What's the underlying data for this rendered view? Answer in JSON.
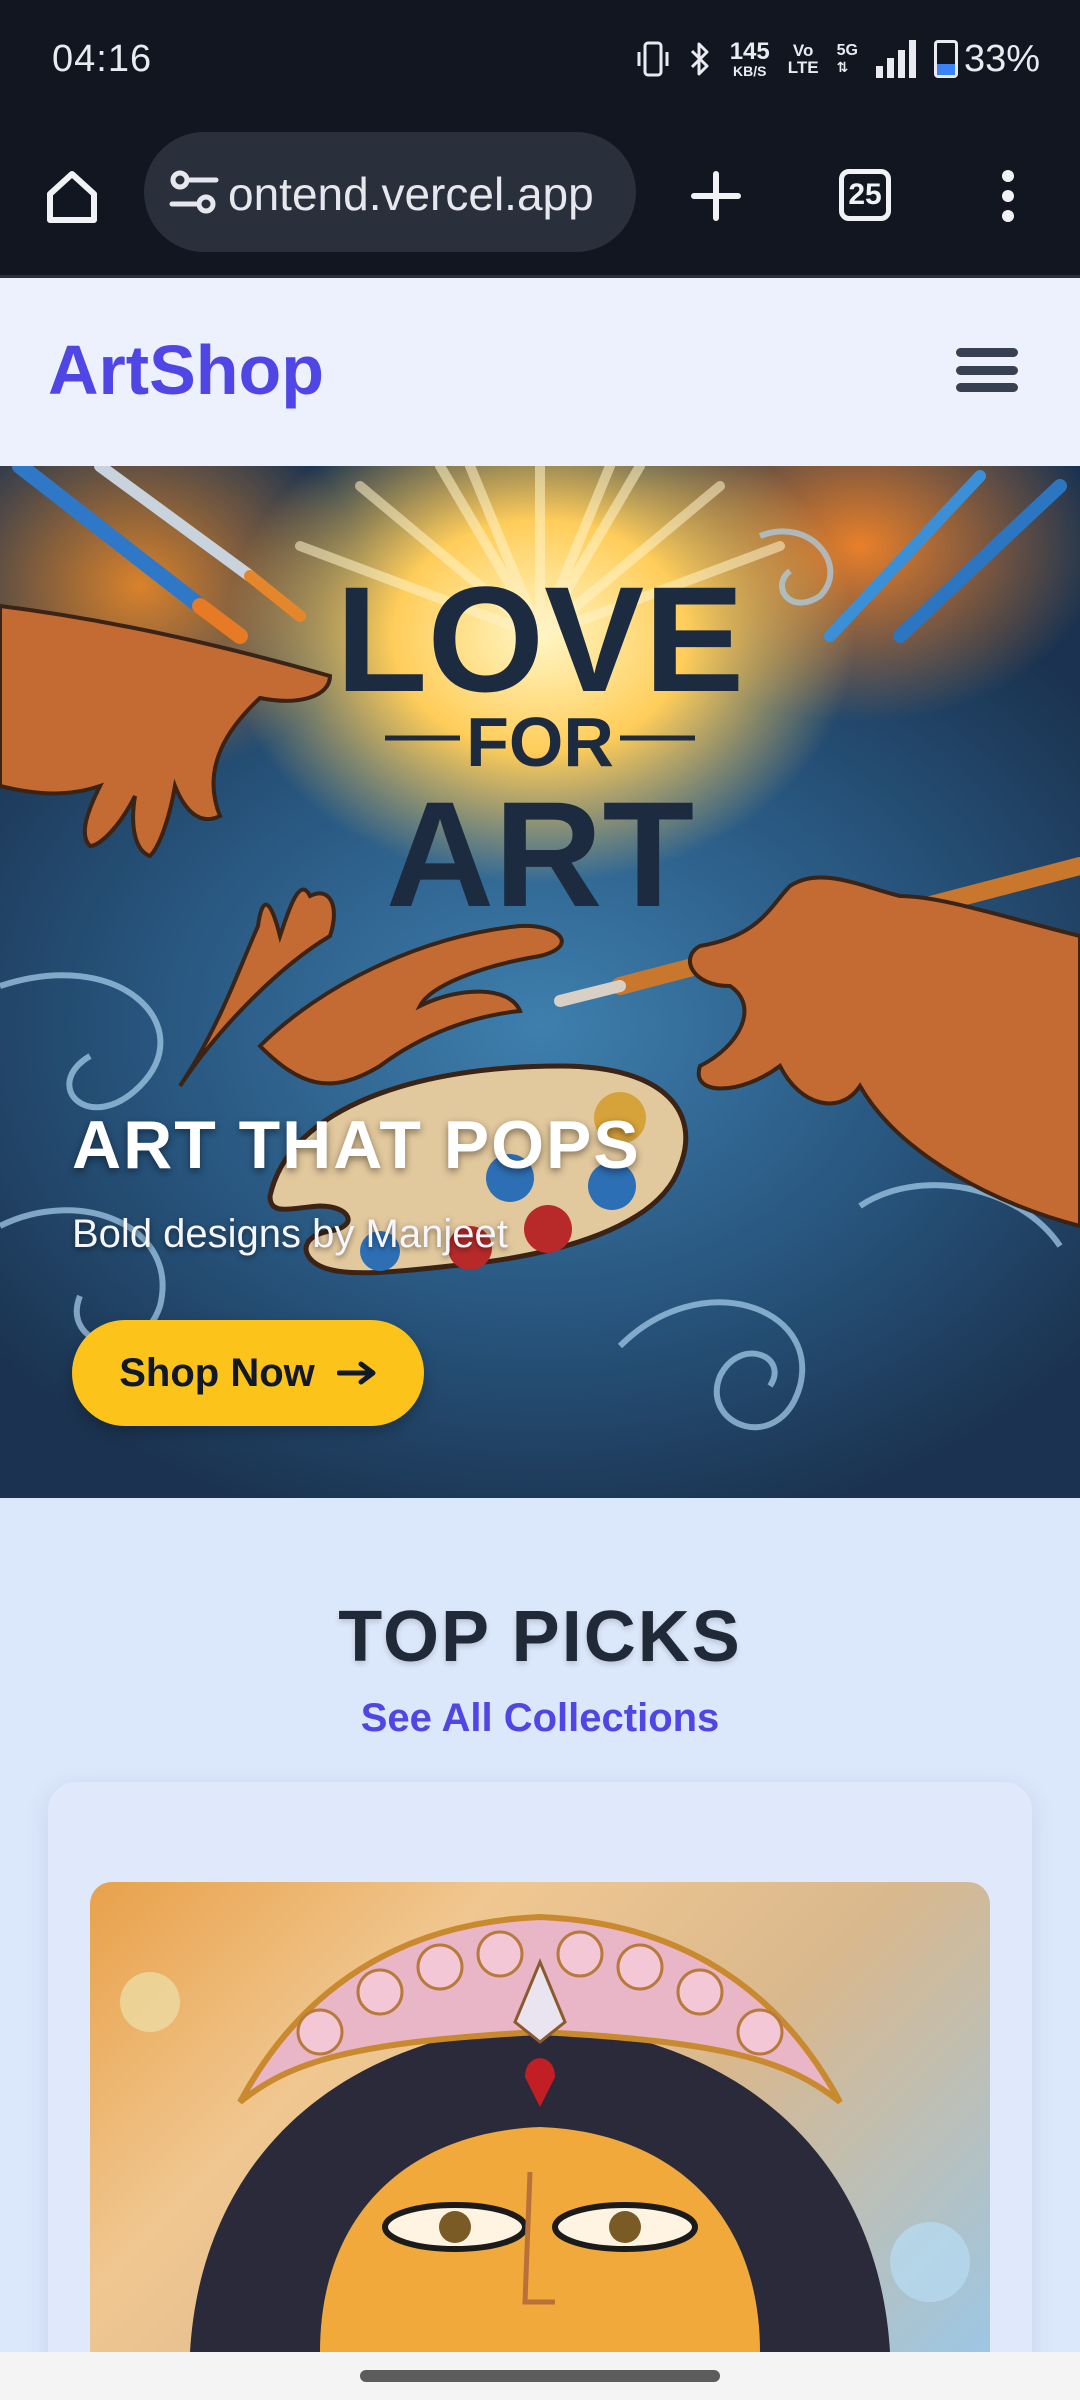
{
  "status_bar": {
    "time": "04:16",
    "net_speed_value": "145",
    "net_speed_unit": "KB/S",
    "volte_top": "Vo",
    "volte_bottom": "LTE",
    "network": "5G",
    "battery": "33%",
    "battery_level": 0.33
  },
  "browser": {
    "url": "ontend.vercel.app",
    "tab_count": "25"
  },
  "header": {
    "logo": "ArtShop"
  },
  "hero": {
    "art_words": [
      "LOVE",
      "FOR",
      "ART"
    ],
    "title": "ART THAT POPS",
    "subtitle": "Bold designs by Manjeet",
    "cta_label": "Shop Now"
  },
  "top_picks": {
    "title": "TOP PICKS",
    "link": "See All Collections"
  },
  "colors": {
    "brand": "#4f46e5",
    "cta": "#fcc41a",
    "toolbar": "#111621"
  }
}
